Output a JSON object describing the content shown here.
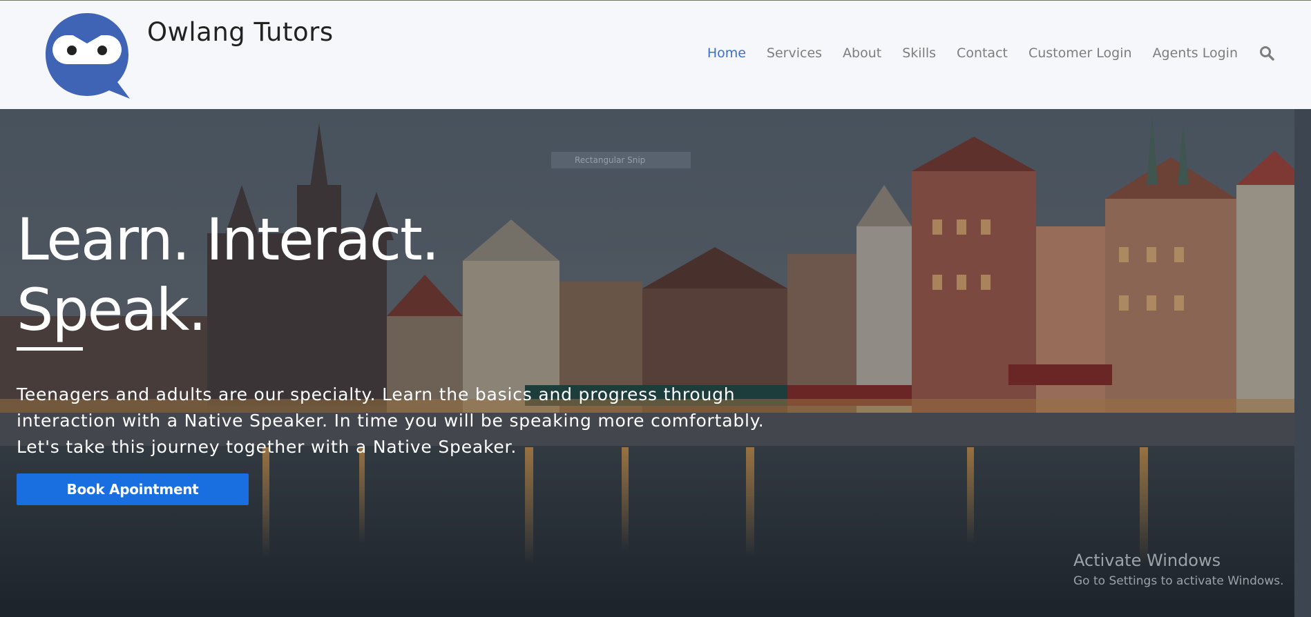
{
  "brand": {
    "name": "Owlang Tutors",
    "logo_icon": "owl-chat-bubble-icon",
    "logo_color": "#3f63b5"
  },
  "nav": {
    "items": [
      {
        "label": "Home",
        "active": true
      },
      {
        "label": "Services",
        "active": false
      },
      {
        "label": "About",
        "active": false
      },
      {
        "label": "Skills",
        "active": false
      },
      {
        "label": "Contact",
        "active": false
      },
      {
        "label": "Customer Login",
        "active": false
      },
      {
        "label": "Agents Login",
        "active": false
      }
    ],
    "search_icon": "search-icon",
    "active_color": "#3b6fd1",
    "inactive_color": "#7d7d7d"
  },
  "hero": {
    "headline_line1": "Learn. Interact.",
    "headline_line2": "Speak.",
    "lead": "Teenagers and adults are our specialty. Learn the basics and progress through interaction with a Native Speaker. In time you will be speaking more comfortably. Let's take this journey together with a Native Speaker.",
    "cta_label": "Book Apointment",
    "cta_color": "#1a6fe0",
    "background": "harbor-cityscape-at-dusk"
  },
  "overlay_tag": {
    "label": "Rectangular Snip"
  },
  "system_watermark": {
    "title": "Activate Windows",
    "subtitle": "Go to Settings to activate Windows."
  }
}
